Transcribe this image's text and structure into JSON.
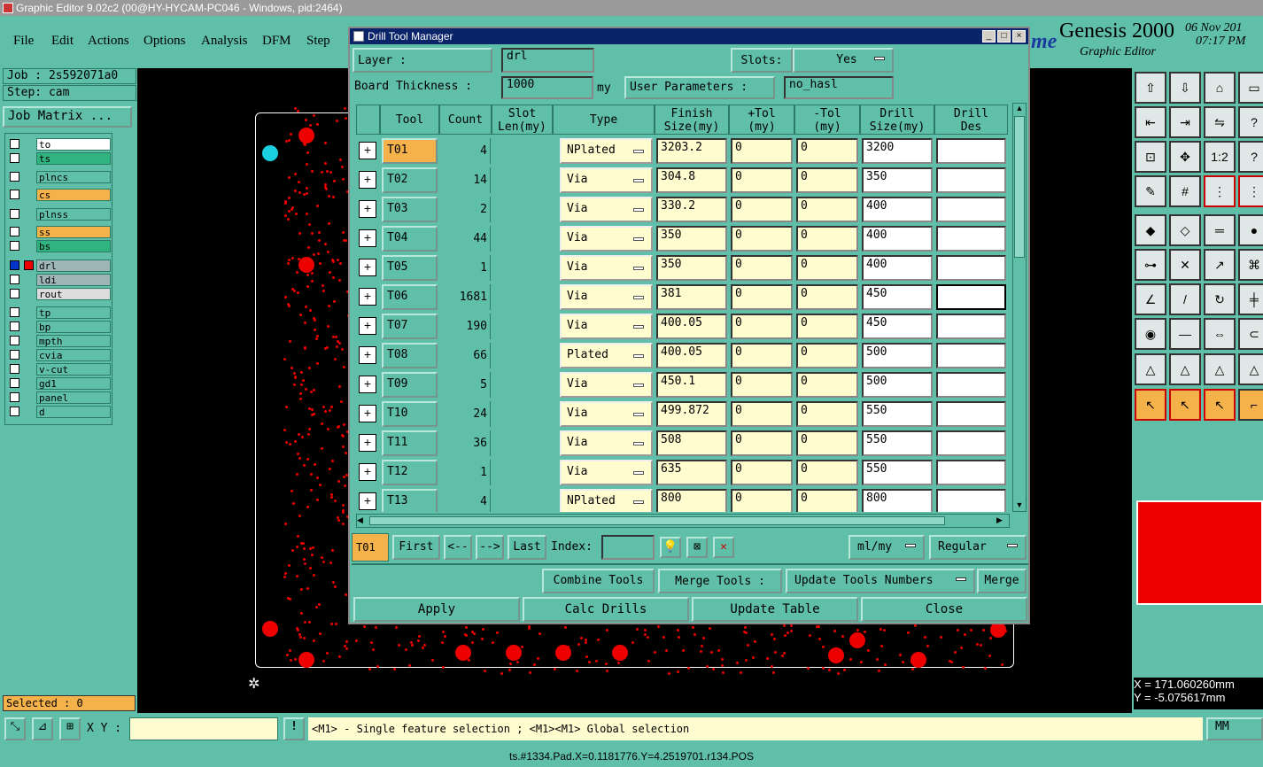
{
  "window": {
    "title": "Graphic Editor 9.02c2 (00@HY-HYCAM-PC046 - Windows, pid:2464)"
  },
  "menu": {
    "items": [
      "File",
      "Edit",
      "Actions",
      "Options",
      "Analysis",
      "DFM",
      "Step"
    ]
  },
  "brand": {
    "logo_fragment": "me",
    "product": "Genesis 2000",
    "subtitle": "Graphic Editor",
    "date": "06 Nov 201",
    "time": "07:17 PM"
  },
  "job": {
    "job_label": "Job : 2s592071a0",
    "step_label": "Step: cam",
    "matrix_button": "Job Matrix ..."
  },
  "layers": [
    {
      "name": "to",
      "bg": "#ffffff"
    },
    {
      "name": "ts",
      "bg": "#2fb37f"
    },
    {
      "name": "plncs",
      "bg": "#5fbfa8"
    },
    {
      "name": "cs",
      "bg": "#f5b24a"
    },
    {
      "name": "plnss",
      "bg": "#5fbfa8"
    },
    {
      "name": "ss",
      "bg": "#f5b24a"
    },
    {
      "name": "bs",
      "bg": "#2fb37f"
    },
    {
      "name": "drl",
      "bg": "#9fb6b6"
    },
    {
      "name": "ldi",
      "bg": "#9fb6b6"
    },
    {
      "name": "rout",
      "bg": "#dcdcdc"
    },
    {
      "name": "tp",
      "bg": "#5fbfa8"
    },
    {
      "name": "bp",
      "bg": "#5fbfa8"
    },
    {
      "name": "mpth",
      "bg": "#5fbfa8"
    },
    {
      "name": "cvia",
      "bg": "#5fbfa8"
    },
    {
      "name": "v-cut",
      "bg": "#5fbfa8"
    },
    {
      "name": "gd1",
      "bg": "#5fbfa8"
    },
    {
      "name": "panel",
      "bg": "#5fbfa8"
    },
    {
      "name": "d",
      "bg": "#5fbfa8"
    }
  ],
  "selected": "Selected : 0",
  "dialog": {
    "title": "Drill Tool Manager",
    "layer_label": "Layer         :",
    "layer_value": "drl",
    "slots_label": "Slots:",
    "slots_value": "Yes",
    "thickness_label": "Board Thickness :",
    "thickness_value": "1000",
    "thickness_unit": "my",
    "user_params_label": "User Parameters :",
    "user_params_value": "no_hasl",
    "headers": [
      "",
      "Tool",
      "Count",
      "Slot\nLen(my)",
      "Type",
      "Finish\nSize(my)",
      "+Tol\n(my)",
      "-Tol\n(my)",
      "Drill\nSize(my)",
      "Drill\nDes"
    ],
    "rows": [
      {
        "tool": "T01",
        "count": "4",
        "type": "NPlated",
        "finish": "3203.2",
        "ptol": "0",
        "ntol": "0",
        "drill": "3200"
      },
      {
        "tool": "T02",
        "count": "14",
        "type": "Via",
        "finish": "304.8",
        "ptol": "0",
        "ntol": "0",
        "drill": "350"
      },
      {
        "tool": "T03",
        "count": "2",
        "type": "Via",
        "finish": "330.2",
        "ptol": "0",
        "ntol": "0",
        "drill": "400"
      },
      {
        "tool": "T04",
        "count": "44",
        "type": "Via",
        "finish": "350",
        "ptol": "0",
        "ntol": "0",
        "drill": "400"
      },
      {
        "tool": "T05",
        "count": "1",
        "type": "Via",
        "finish": "350",
        "ptol": "0",
        "ntol": "0",
        "drill": "400"
      },
      {
        "tool": "T06",
        "count": "1681",
        "type": "Via",
        "finish": "381",
        "ptol": "0",
        "ntol": "0",
        "drill": "450"
      },
      {
        "tool": "T07",
        "count": "190",
        "type": "Via",
        "finish": "400.05",
        "ptol": "0",
        "ntol": "0",
        "drill": "450"
      },
      {
        "tool": "T08",
        "count": "66",
        "type": "Plated",
        "finish": "400.05",
        "ptol": "0",
        "ntol": "0",
        "drill": "500"
      },
      {
        "tool": "T09",
        "count": "5",
        "type": "Via",
        "finish": "450.1",
        "ptol": "0",
        "ntol": "0",
        "drill": "500"
      },
      {
        "tool": "T10",
        "count": "24",
        "type": "Via",
        "finish": "499.872",
        "ptol": "0",
        "ntol": "0",
        "drill": "550"
      },
      {
        "tool": "T11",
        "count": "36",
        "type": "Via",
        "finish": "508",
        "ptol": "0",
        "ntol": "0",
        "drill": "550"
      },
      {
        "tool": "T12",
        "count": "1",
        "type": "Via",
        "finish": "635",
        "ptol": "0",
        "ntol": "0",
        "drill": "550"
      },
      {
        "tool": "T13",
        "count": "4",
        "type": "NPlated",
        "finish": "800",
        "ptol": "0",
        "ntol": "0",
        "drill": "800"
      }
    ],
    "current_tool": "T01",
    "nav": {
      "first": "First",
      "prev": "<--",
      "next": "-->",
      "last": "Last",
      "index_label": "Index:"
    },
    "units": "ml/my",
    "mode": "Regular",
    "combine": "Combine Tools",
    "merge_tools": "Merge Tools :",
    "update_numbers": "Update Tools Numbers",
    "merge": "Merge",
    "apply": "Apply",
    "calc": "Calc Drills",
    "update_table": "Update Table",
    "close": "Close"
  },
  "status": {
    "xy_label": "X Y :",
    "message": "<M1> - Single feature selection ; <M1><M1> Global selection",
    "units": "MM",
    "bottom": "ts.#1334.Pad.X=0.1181776.Y=4.2519701.r134.POS"
  },
  "coords": {
    "x": "X = 171.060260mm",
    "y": "Y = -5.075617mm"
  },
  "colors": {
    "teal": "#5fbfa8",
    "orange": "#f5b24a",
    "drill_red": "#e00000",
    "cream": "#fffcd0"
  }
}
